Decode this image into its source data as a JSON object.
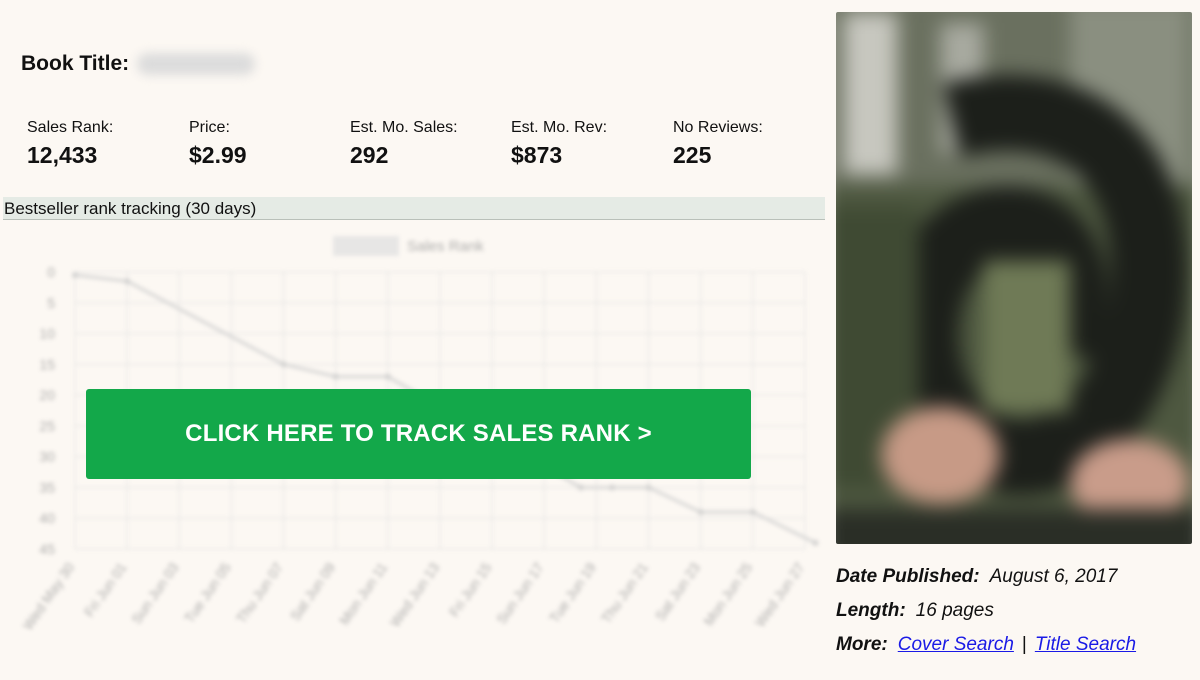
{
  "book": {
    "title_label": "Book Title:"
  },
  "stats": [
    {
      "label": "Sales Rank:",
      "value": "12,433"
    },
    {
      "label": "Price:",
      "value": "$2.99"
    },
    {
      "label": "Est. Mo. Sales:",
      "value": "292"
    },
    {
      "label": "Est. Mo. Rev:",
      "value": "$873"
    },
    {
      "label": "No Reviews:",
      "value": "225"
    }
  ],
  "section_title": "Bestseller rank tracking (30 days)",
  "cta_label": "CLICK HERE TO TRACK SALES RANK >",
  "meta": {
    "date_label": "Date Published:",
    "date_value": "August 6, 2017",
    "length_label": "Length:",
    "length_value": "16 pages",
    "more_label": "More:",
    "cover_search": "Cover Search",
    "separator": "|",
    "title_search": "Title Search"
  },
  "chart_data": {
    "type": "line",
    "legend": "Sales Rank",
    "x_labels": [
      "Wed May 30",
      "Fri Jun 01",
      "Sun Jun 03",
      "Tue Jun 05",
      "Thu Jun 07",
      "Sat Jun 09",
      "Mon Jun 11",
      "Wed Jun 13",
      "Fri Jun 15",
      "Sun Jun 17",
      "Tue Jun 19",
      "Thu Jun 21",
      "Sat Jun 23",
      "Mon Jun 25",
      "Wed Jun 27"
    ],
    "y_ticks": [
      0,
      5,
      10,
      15,
      20,
      25,
      30,
      35,
      40,
      45
    ],
    "ylim": [
      0,
      45
    ],
    "y_reversed": true,
    "points": [
      {
        "x": 0,
        "y": 0.5
      },
      {
        "x": 1,
        "y": 1.5
      },
      {
        "x": 4,
        "y": 15
      },
      {
        "x": 5,
        "y": 17
      },
      {
        "x": 6,
        "y": 17
      },
      {
        "x": 9.7,
        "y": 35
      },
      {
        "x": 10.3,
        "y": 35
      },
      {
        "x": 11,
        "y": 35
      },
      {
        "x": 12,
        "y": 39
      },
      {
        "x": 13,
        "y": 39
      },
      {
        "x": 14.2,
        "y": 44
      }
    ]
  }
}
